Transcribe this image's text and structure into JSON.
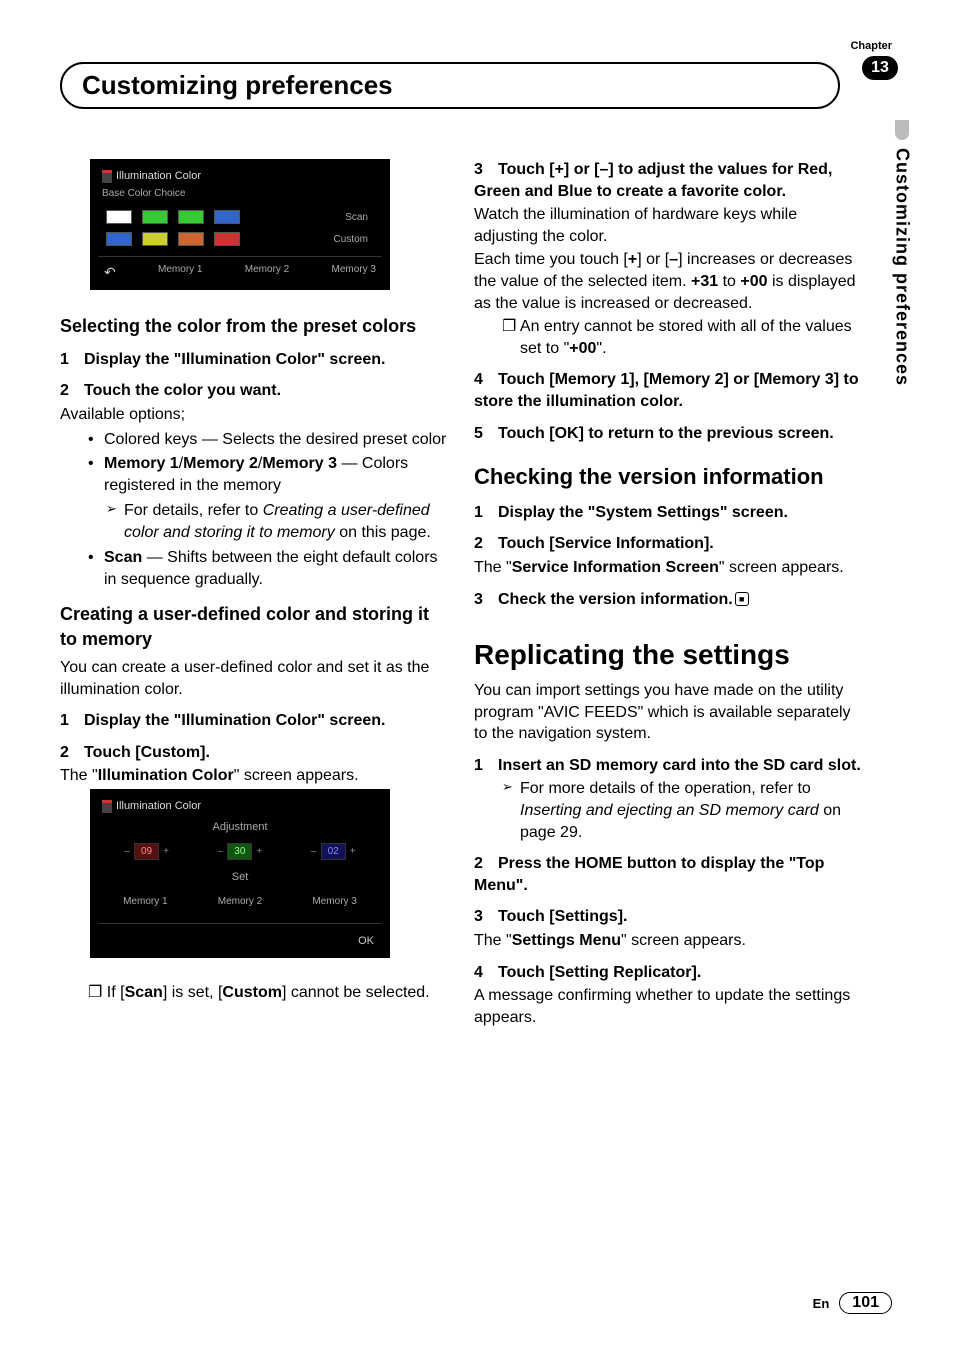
{
  "chapter": {
    "label": "Chapter",
    "number": "13"
  },
  "title": "Customizing preferences",
  "side_tab": "Customizing preferences",
  "footer": {
    "lang": "En",
    "page": "101"
  },
  "screenshot1": {
    "title": "Illumination Color",
    "subtitle": "Base Color Choice",
    "scan": "Scan",
    "custom": "Custom",
    "mem1": "Memory 1",
    "mem2": "Memory 2",
    "mem3": "Memory 3"
  },
  "screenshot2": {
    "title": "Illumination Color",
    "adjustment": "Adjustment",
    "r": "09",
    "g": "30",
    "b": "02",
    "set": "Set",
    "mem1": "Memory 1",
    "mem2": "Memory 2",
    "mem3": "Memory 3",
    "ok": "OK"
  },
  "left": {
    "h2a": "Selecting the color from the preset colors",
    "s1": "Display the \"Illumination Color\" screen.",
    "s2": "Touch the color you want.",
    "avail": "Available options;",
    "b1a": "Colored keys — Selects the desired preset color",
    "b2a": "Memory 1",
    "b2b": "/",
    "b2c": "Memory 2",
    "b2d": "/",
    "b2e": "Memory 3",
    "b2f": " — Colors registered in the memory",
    "b2ref_pre": "For details, refer to ",
    "b2ref_it": "Creating a user-defined color and storing it to memory",
    "b2ref_post": " on this page.",
    "b3a": "Scan",
    "b3b": " — Shifts between the eight default colors in sequence gradually.",
    "h2b": "Creating a user-defined color and storing it to memory",
    "p_intro": "You can create a user-defined color and set it as the illumination color.",
    "sb1": "Display the \"Illumination Color\" screen.",
    "sb2": "Touch [Custom].",
    "sb2_after_pre": "The \"",
    "sb2_after_bold": "Illumination Color",
    "sb2_after_post": "\" screen appears.",
    "note_scan_pre": "If [",
    "note_scan_b1": "Scan",
    "note_scan_mid": "] is set, [",
    "note_scan_b2": "Custom",
    "note_scan_post": "] cannot be selected."
  },
  "right": {
    "s3": "Touch [+] or [–] to adjust the values for Red, Green and Blue to create a favorite color.",
    "p3a": "Watch the illumination of hardware keys while adjusting the color.",
    "p3b_pre": "Each time you touch [",
    "p3b_plus": "+",
    "p3b_mid1": "] or [",
    "p3b_minus": "–",
    "p3b_mid2": "] increases or decreases the value of the selected item. ",
    "p3b_31": "+31",
    "p3b_mid3": " to ",
    "p3b_00": "+00",
    "p3b_post": " is displayed as the value is increased or decreased.",
    "note3_pre": "An entry cannot be stored with all of the values set to \"",
    "note3_b": "+00",
    "note3_post": "\".",
    "s4": "Touch [Memory 1], [Memory 2] or [Memory 3] to store the illumination color.",
    "s5": "Touch [OK] to return to the previous screen.",
    "h3a": "Checking the version information",
    "cs1": "Display the \"System Settings\" screen.",
    "cs2": "Touch [Service Information].",
    "cs2_after_pre": "The \"",
    "cs2_after_bold": "Service Information Screen",
    "cs2_after_post": "\" screen appears.",
    "cs3": "Check the version information.",
    "h4": "Replicating the settings",
    "rp_intro": "You can import settings you have made on the utility program \"AVIC FEEDS\" which is available separately to the navigation system.",
    "rs1": "Insert an SD memory card into the SD card slot.",
    "rs1_ref_pre": "For more details of the operation, refer to ",
    "rs1_ref_it": "Inserting and ejecting an SD memory card",
    "rs1_ref_post": " on page 29.",
    "rs2": "Press the HOME button to display the \"Top Menu\".",
    "rs3": "Touch [Settings].",
    "rs3_after_pre": "The \"",
    "rs3_after_bold": "Settings Menu",
    "rs3_after_post": "\" screen appears.",
    "rs4": "Touch [Setting Replicator].",
    "rs4_after": "A message confirming whether to update the settings appears."
  }
}
